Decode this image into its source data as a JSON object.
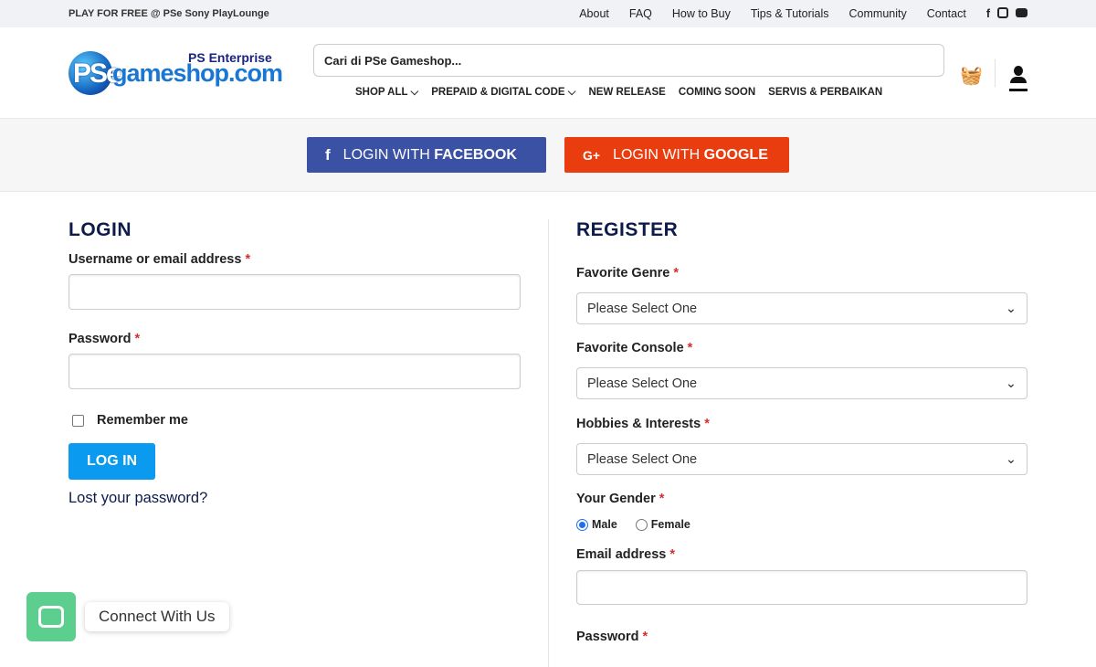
{
  "topbar": {
    "promo": "PLAY FOR FREE @ PSe Sony PlayLounge",
    "links": [
      "About",
      "FAQ",
      "How to Buy",
      "Tips & Tutorials",
      "Community",
      "Contact"
    ],
    "social_icons": [
      "facebook-icon",
      "instagram-icon",
      "youtube-icon"
    ]
  },
  "header": {
    "logo_tagline": "PS Enterprise",
    "logo_text": "PSegameshop.com",
    "search_placeholder": "Cari di PSe Gameshop...",
    "nav": [
      {
        "label": "SHOP ALL",
        "dropdown": true
      },
      {
        "label": "PREPAID & DIGITAL CODE",
        "dropdown": true
      },
      {
        "label": "NEW RELEASE"
      },
      {
        "label": "COMING SOON"
      },
      {
        "label": "SERVIS & PERBAIKAN"
      }
    ]
  },
  "social_login": {
    "facebook_prefix": "LOGIN WITH",
    "facebook_brand": "FACEBOOK",
    "google_prefix": "LOGIN WITH",
    "google_brand": "GOOGLE"
  },
  "login": {
    "title": "LOGIN",
    "username_label": "Username or email address",
    "password_label": "Password",
    "remember_label": "Remember me",
    "submit": "LOG IN",
    "lost_password": "Lost your password?"
  },
  "register": {
    "title": "REGISTER",
    "genre_label": "Favorite Genre",
    "console_label": "Favorite Console",
    "hobbies_label": "Hobbies & Interests",
    "select_placeholder": "Please Select One",
    "gender_label": "Your Gender",
    "male": "Male",
    "female": "Female",
    "email_label": "Email address",
    "password_label": "Password"
  },
  "chat": {
    "label": "Connect With Us"
  },
  "required_mark": "*"
}
